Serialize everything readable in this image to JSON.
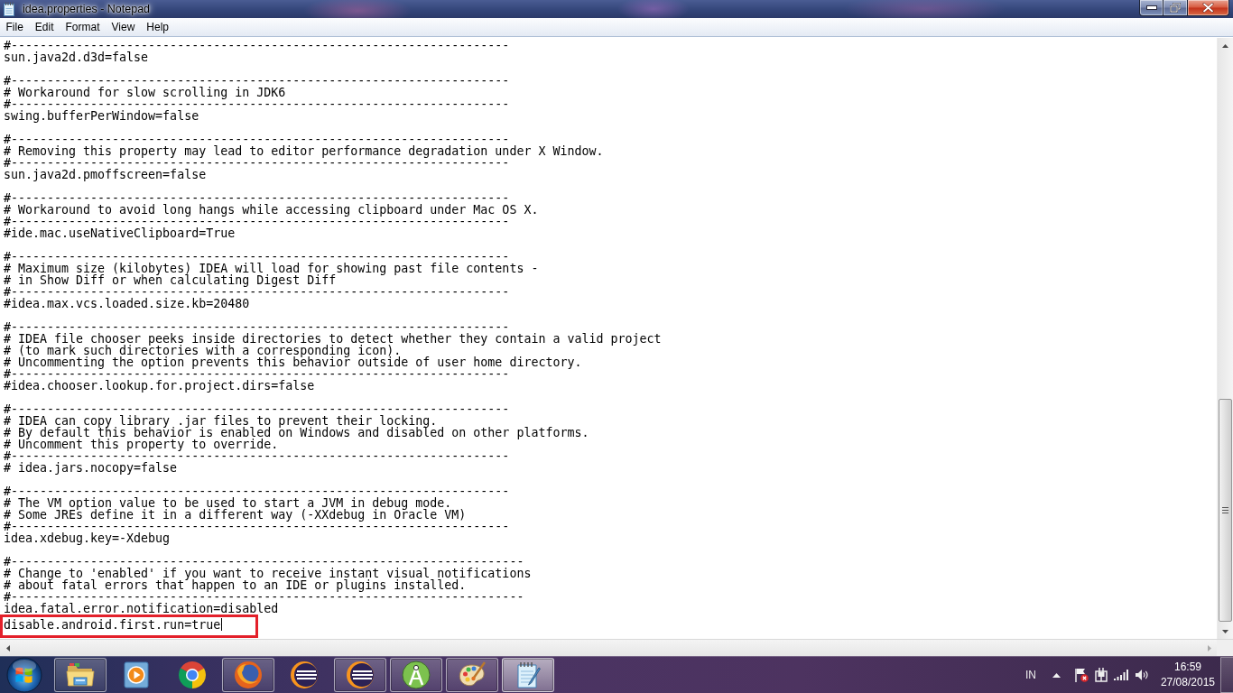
{
  "window": {
    "title": "idea.properties - Notepad",
    "maximized": true
  },
  "menu": [
    "File",
    "Edit",
    "Format",
    "View",
    "Help"
  ],
  "editor": {
    "blocks": [
      [
        "#---------------------------------------------------------------------",
        "sun.java2d.d3d=false"
      ],
      [
        "#---------------------------------------------------------------------",
        "# Workaround for slow scrolling in JDK6",
        "#---------------------------------------------------------------------",
        "swing.bufferPerWindow=false"
      ],
      [
        "#---------------------------------------------------------------------",
        "# Removing this property may lead to editor performance degradation under X Window.",
        "#---------------------------------------------------------------------",
        "sun.java2d.pmoffscreen=false"
      ],
      [
        "#---------------------------------------------------------------------",
        "# Workaround to avoid long hangs while accessing clipboard under Mac OS X.",
        "#---------------------------------------------------------------------",
        "#ide.mac.useNativeClipboard=True"
      ],
      [
        "#---------------------------------------------------------------------",
        "# Maximum size (kilobytes) IDEA will load for showing past file contents -",
        "# in Show Diff or when calculating Digest Diff",
        "#---------------------------------------------------------------------",
        "#idea.max.vcs.loaded.size.kb=20480"
      ],
      [
        "#---------------------------------------------------------------------",
        "# IDEA file chooser peeks inside directories to detect whether they contain a valid project",
        "# (to mark such directories with a corresponding icon).",
        "# Uncommenting the option prevents this behavior outside of user home directory.",
        "#---------------------------------------------------------------------",
        "#idea.chooser.lookup.for.project.dirs=false"
      ],
      [
        "#---------------------------------------------------------------------",
        "# IDEA can copy library .jar files to prevent their locking.",
        "# By default this behavior is enabled on Windows and disabled on other platforms.",
        "# Uncomment this property to override.",
        "#---------------------------------------------------------------------",
        "# idea.jars.nocopy=false"
      ],
      [
        "#---------------------------------------------------------------------",
        "# The VM option value to be used to start a JVM in debug mode.",
        "# Some JREs define it in a different way (-XXdebug in Oracle VM)",
        "#---------------------------------------------------------------------",
        "idea.xdebug.key=-Xdebug"
      ],
      [
        "#-----------------------------------------------------------------------",
        "# Change to 'enabled' if you want to receive instant visual notifications",
        "# about fatal errors that happen to an IDE or plugins installed.",
        "#-----------------------------------------------------------------------",
        "idea.fatal.error.notification=disabled"
      ]
    ],
    "marked_line": {
      "text": "disable.android.first.run=true",
      "cursor": true
    }
  },
  "taskbar": {
    "apps": [
      {
        "kind": "folder",
        "running": true,
        "active": false
      },
      {
        "kind": "player",
        "running": false,
        "active": false
      },
      {
        "kind": "wheel",
        "running": false,
        "active": false
      },
      {
        "kind": "fox",
        "running": true,
        "active": false
      },
      {
        "kind": "sphere",
        "running": false,
        "active": false
      },
      {
        "kind": "sphere",
        "running": true,
        "active": false
      },
      {
        "kind": "compass",
        "running": true,
        "active": false
      },
      {
        "kind": "palette",
        "running": true,
        "active": false
      },
      {
        "kind": "notepad",
        "running": true,
        "active": true
      }
    ],
    "tray": {
      "language": "IN",
      "time": "16:59",
      "date": "27/08/2015"
    }
  }
}
